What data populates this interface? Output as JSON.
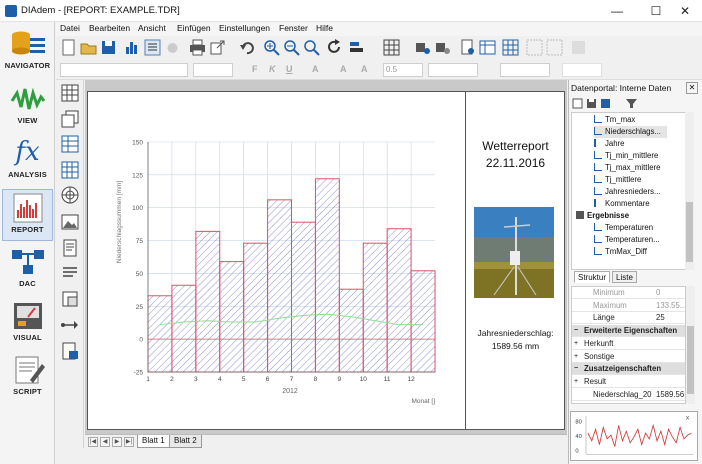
{
  "window": {
    "title": "DIAdem - [REPORT:  EXAMPLE.TDR]",
    "controls": [
      "minimize-icon",
      "maximize-icon",
      "close-icon"
    ]
  },
  "navigator": {
    "items": [
      {
        "label": "NAVIGATOR",
        "icon": "database-icon"
      },
      {
        "label": "VIEW",
        "icon": "view-curve-icon"
      },
      {
        "label": "ANALYSIS",
        "icon": "fx-icon",
        "glyph": "fx"
      },
      {
        "label": "REPORT",
        "icon": "report-chart-icon",
        "active": true
      },
      {
        "label": "DAC",
        "icon": "dac-blocks-icon"
      },
      {
        "label": "VISUAL",
        "icon": "visual-meter-icon"
      },
      {
        "label": "SCRIPT",
        "icon": "script-icon"
      }
    ]
  },
  "menu": [
    "Datei",
    "Bearbeiten",
    "Ansicht",
    "Einfügen",
    "Einstellungen",
    "Fenster",
    "Hilfe"
  ],
  "toolbar2": {
    "font_styles": [
      "F",
      "K",
      "U"
    ],
    "line_width_value": "0.5"
  },
  "report": {
    "title_line1": "Wetterreport",
    "title_line2": "22.11.2016",
    "precip_label": "Jahresniederschlag:",
    "precip_value": "1589.56 mm"
  },
  "chart_data": {
    "type": "bar",
    "ylabel": "Niederschlagssummen [mm]",
    "xlabel": "Monat []",
    "x_caption": "2012",
    "ylim": [
      -25,
      150
    ],
    "yticks": [
      -25,
      0,
      25,
      50,
      75,
      100,
      125,
      150
    ],
    "categories": [
      "1",
      "2",
      "3",
      "4",
      "5",
      "6",
      "7",
      "8",
      "9",
      "10",
      "11",
      "12"
    ],
    "series": [
      {
        "values": [
          33,
          41,
          82,
          59,
          73,
          106,
          89,
          122,
          38,
          73,
          84,
          52
        ],
        "color": "#e05060",
        "fill": "hatched-blue"
      },
      {
        "values": [
          11,
          13,
          14,
          13,
          13,
          16,
          18,
          19,
          17,
          14,
          11,
          11
        ],
        "color": "#8ee08e"
      }
    ],
    "grid": true
  },
  "sheet_tabs": [
    "Blatt 1",
    "Blatt 2"
  ],
  "portal": {
    "title": "Datenportal: Interne Daten",
    "tree": [
      {
        "label": "Tm_max",
        "level": 2,
        "icon": "channel-icon"
      },
      {
        "label": "Niederschlags...",
        "level": 2,
        "icon": "channel-icon",
        "selected": true
      },
      {
        "label": "Jahre",
        "level": 2,
        "icon": "text-channel-icon"
      },
      {
        "label": "Tj_min_mittlere",
        "level": 2,
        "icon": "channel-icon"
      },
      {
        "label": "Tj_max_mittlere",
        "level": 2,
        "icon": "channel-icon"
      },
      {
        "label": "Tj_mittlere",
        "level": 2,
        "icon": "channel-icon"
      },
      {
        "label": "Jahresnieders...",
        "level": 2,
        "icon": "channel-icon"
      },
      {
        "label": "Kommentare",
        "level": 2,
        "icon": "text-channel-icon"
      },
      {
        "label": "Ergebnisse",
        "level": 1,
        "icon": "group-icon",
        "bold": true
      },
      {
        "label": "Temperaturen",
        "level": 2,
        "icon": "channel-icon"
      },
      {
        "label": "Temperaturen...",
        "level": 2,
        "icon": "channel-icon"
      },
      {
        "label": "TmMax_Diff",
        "level": 2,
        "icon": "channel-icon"
      }
    ],
    "tabs": [
      "Struktur",
      "Liste"
    ],
    "properties": [
      {
        "key": "Minimum",
        "value": "0",
        "type": "dim"
      },
      {
        "key": "Maximum",
        "value": "133.55...",
        "type": "dim"
      },
      {
        "key": "Länge",
        "value": "25",
        "type": "val"
      },
      {
        "key": "Erweiterte Eigenschaften",
        "value": "",
        "type": "sec"
      },
      {
        "key": "Herkunft",
        "value": "",
        "type": "grp"
      },
      {
        "key": "Sonstige",
        "value": "",
        "type": "grp"
      },
      {
        "key": "Zusatzeigenschaften",
        "value": "",
        "type": "sec"
      },
      {
        "key": "Result",
        "value": "",
        "type": "grp"
      },
      {
        "key": "Niederschlag_20",
        "value": "1589.56",
        "type": "val"
      }
    ],
    "preview_ticks": [
      "80",
      "40",
      "0"
    ]
  }
}
